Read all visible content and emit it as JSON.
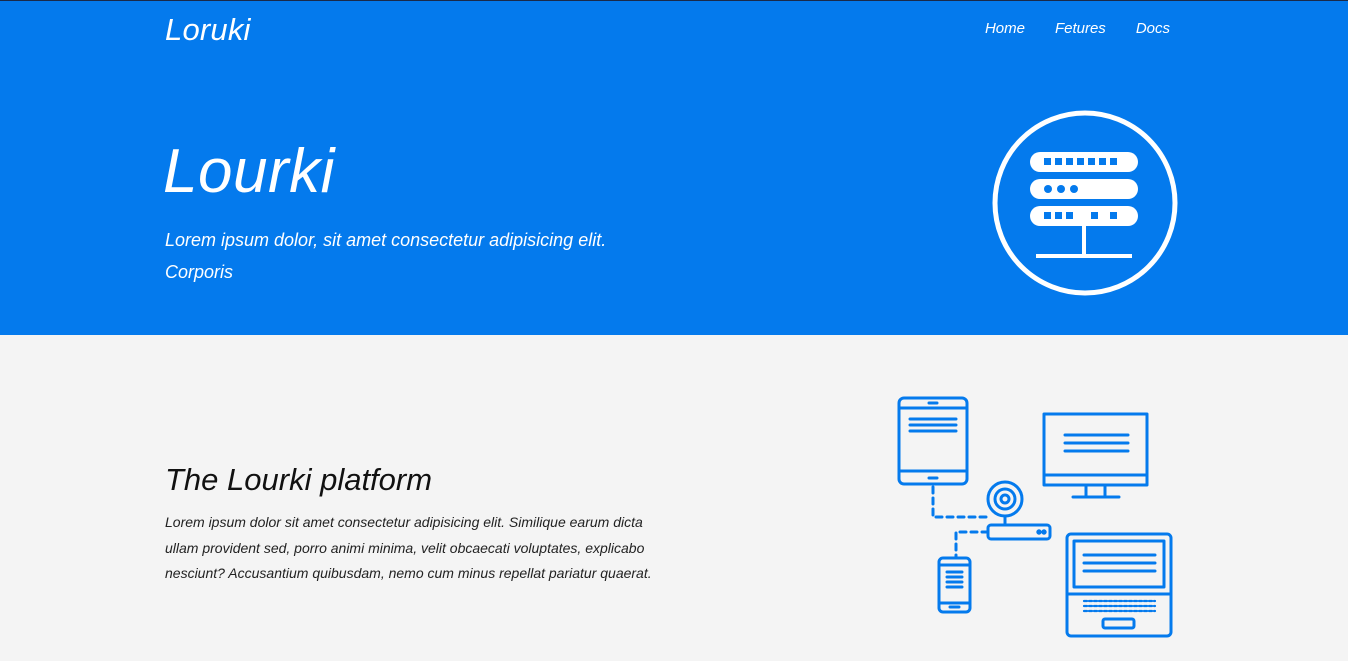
{
  "header": {
    "brand": "Loruki",
    "nav": [
      {
        "label": "Home"
      },
      {
        "label": "Fetures"
      },
      {
        "label": "Docs"
      }
    ]
  },
  "hero": {
    "title": "Lourki",
    "subtitle": "Lorem ipsum dolor, sit amet consectetur adipisicing elit. Corporis",
    "icon": "server-icon"
  },
  "platform": {
    "title": "The Lourki platform",
    "text": "Lorem ipsum dolor sit amet consectetur adipisicing elit. Similique earum dicta ullam provident sed, porro animi minima, velit obcaecati voluptates, explicabo nesciunt? Accusantium quibusdam, nemo cum minus repellat pariatur quaerat.",
    "icon": "connected-devices-icon"
  },
  "colors": {
    "primary": "#047aed",
    "light_bg": "#f4f4f4",
    "white": "#ffffff"
  }
}
